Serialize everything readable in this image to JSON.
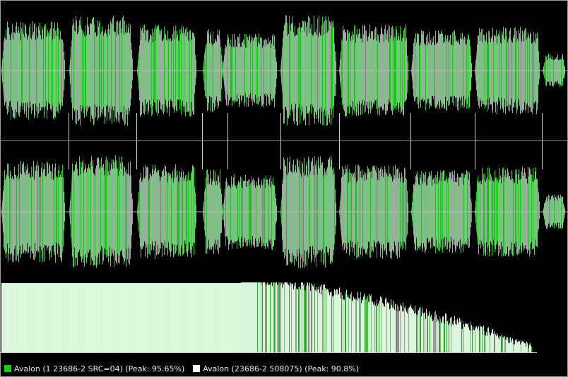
{
  "colors": {
    "background": "#000000",
    "wave_fill": "#7fbe86",
    "wave_bright": "#18c418",
    "wave_gray": "#a7a7a7",
    "center_line": "#b9b9b9",
    "separator": "#8f8f8f",
    "spectrum_fill": "#d8f7d8"
  },
  "legend": {
    "items": [
      {
        "label": "Avalon (1 23686-2 SRC=04) (Peak: 95.65%)",
        "swatch_color": "#13d013",
        "icon": "green-square-icon"
      },
      {
        "label": "Avalon (23686-2 508075) (Peak: 90.8%)",
        "swatch_color": "#ffffff",
        "icon": "white-square-icon"
      }
    ]
  }
}
